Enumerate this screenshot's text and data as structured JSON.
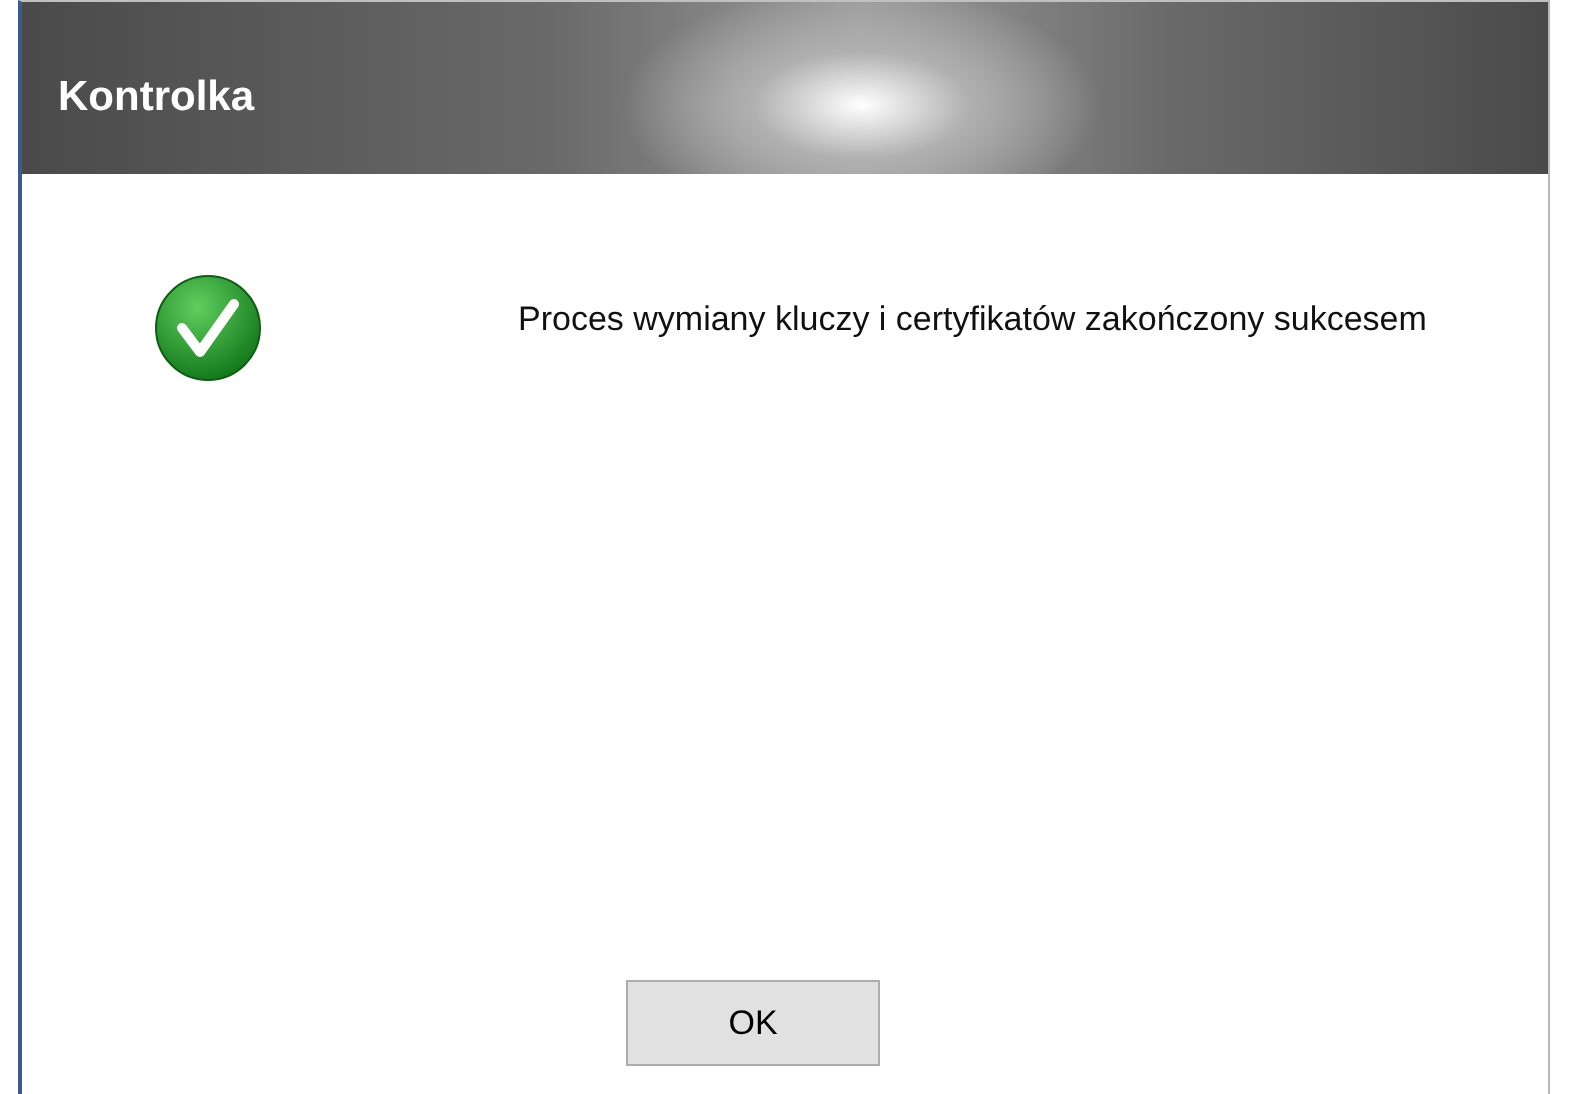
{
  "window": {
    "title": "Kontrolka"
  },
  "message": "Proces wymiany kluczy i certyfikatów zakończony sukcesem",
  "buttons": [
    "OK"
  ]
}
